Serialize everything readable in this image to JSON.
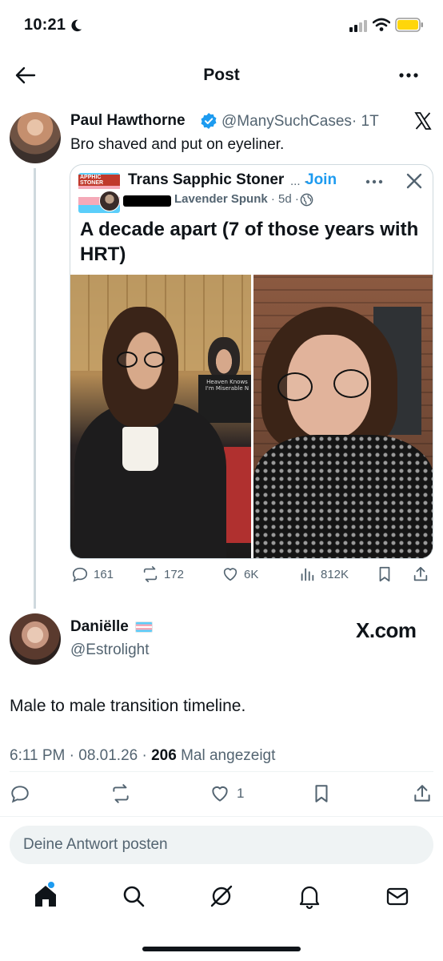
{
  "status_bar": {
    "time": "10:21"
  },
  "header": {
    "title": "Post"
  },
  "original": {
    "author_name": "Paul Hawthorne",
    "handle": "@ManySuchCases",
    "age": "· 1T",
    "text": "Bro shaved and put on eyeliner."
  },
  "quoted": {
    "community_name": "Trans Sapphic Stoner",
    "ellipsis": "...",
    "dot": "·",
    "join_label": "Join",
    "author": "Lavender Spunk",
    "age": "· 5d ·",
    "text": "A decade apart (7 of those years with HRT)",
    "community_icon_text": "APPHIC STONER",
    "photo_shirt_text": "Heaven Knows I'm Miserable N"
  },
  "stats": {
    "replies": "161",
    "reposts": "172",
    "likes": "6K",
    "views": "812K"
  },
  "reply": {
    "author_name": "Daniëlle",
    "handle": "@Estrolight",
    "source": "X.com",
    "text": "Male to male transition timeline.",
    "time": "6:11 PM",
    "date": "08.01.26",
    "views_count": "206",
    "views_label": "Mal angezeigt",
    "likes": "1"
  },
  "composer": {
    "placeholder": "Deine Antwort posten"
  },
  "colors": {
    "accent": "#1d9bf0",
    "text": "#0f1419",
    "secondary": "#536471"
  }
}
